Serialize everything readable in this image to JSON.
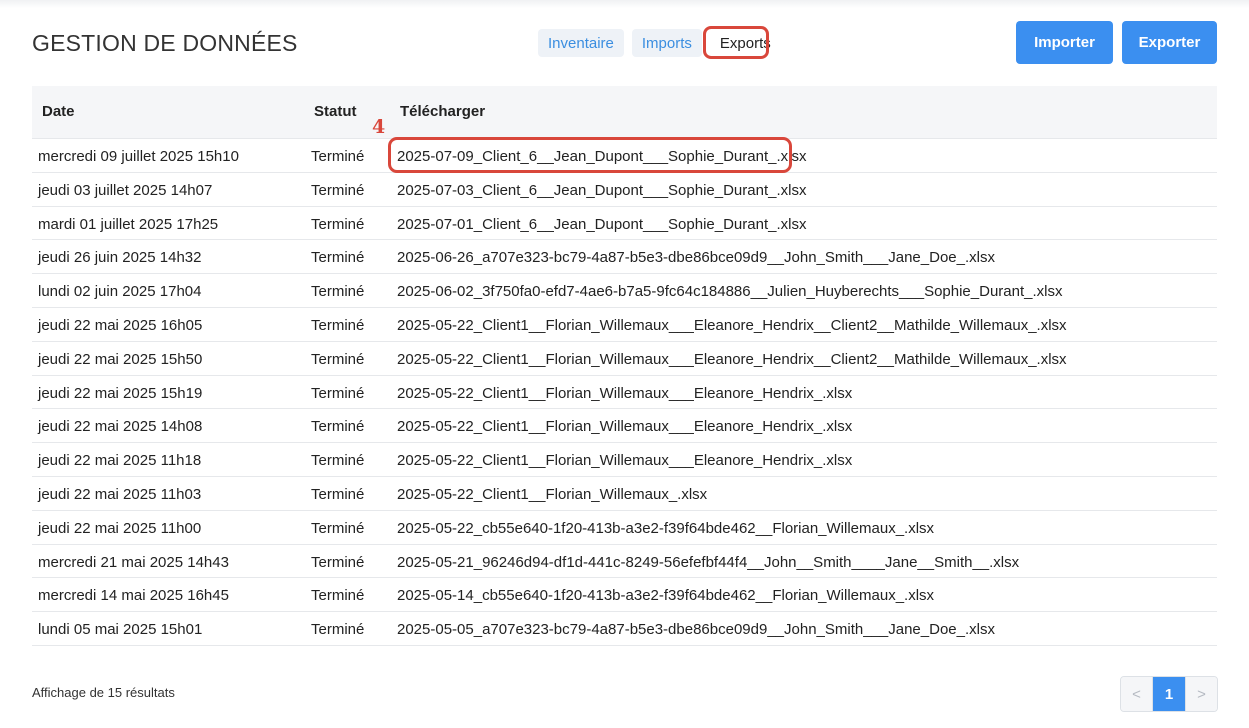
{
  "page": {
    "title": "GESTION DE DONNÉES"
  },
  "tabs": [
    {
      "label": "Inventaire",
      "active": false
    },
    {
      "label": "Imports",
      "active": false
    },
    {
      "label": "Exports",
      "active": true
    }
  ],
  "actions": {
    "import_label": "Importer",
    "export_label": "Exporter"
  },
  "table": {
    "headers": {
      "date": "Date",
      "status": "Statut",
      "download": "Télécharger"
    },
    "rows": [
      {
        "date": "mercredi 09 juillet 2025 15h10",
        "status": "Terminé",
        "file": "2025-07-09_Client_6__Jean_Dupont___Sophie_Durant_.xlsx"
      },
      {
        "date": "jeudi 03 juillet 2025 14h07",
        "status": "Terminé",
        "file": "2025-07-03_Client_6__Jean_Dupont___Sophie_Durant_.xlsx"
      },
      {
        "date": "mardi 01 juillet 2025 17h25",
        "status": "Terminé",
        "file": "2025-07-01_Client_6__Jean_Dupont___Sophie_Durant_.xlsx"
      },
      {
        "date": "jeudi 26 juin 2025 14h32",
        "status": "Terminé",
        "file": "2025-06-26_a707e323-bc79-4a87-b5e3-dbe86bce09d9__John_Smith___Jane_Doe_.xlsx"
      },
      {
        "date": "lundi 02 juin 2025 17h04",
        "status": "Terminé",
        "file": "2025-06-02_3f750fa0-efd7-4ae6-b7a5-9fc64c184886__Julien_Huyberechts___Sophie_Durant_.xlsx"
      },
      {
        "date": "jeudi 22 mai 2025 16h05",
        "status": "Terminé",
        "file": "2025-05-22_Client1__Florian_Willemaux___Eleanore_Hendrix__Client2__Mathilde_Willemaux_.xlsx"
      },
      {
        "date": "jeudi 22 mai 2025 15h50",
        "status": "Terminé",
        "file": "2025-05-22_Client1__Florian_Willemaux___Eleanore_Hendrix__Client2__Mathilde_Willemaux_.xlsx"
      },
      {
        "date": "jeudi 22 mai 2025 15h19",
        "status": "Terminé",
        "file": "2025-05-22_Client1__Florian_Willemaux___Eleanore_Hendrix_.xlsx"
      },
      {
        "date": "jeudi 22 mai 2025 14h08",
        "status": "Terminé",
        "file": "2025-05-22_Client1__Florian_Willemaux___Eleanore_Hendrix_.xlsx"
      },
      {
        "date": "jeudi 22 mai 2025 11h18",
        "status": "Terminé",
        "file": "2025-05-22_Client1__Florian_Willemaux___Eleanore_Hendrix_.xlsx"
      },
      {
        "date": "jeudi 22 mai 2025 11h03",
        "status": "Terminé",
        "file": "2025-05-22_Client1__Florian_Willemaux_.xlsx"
      },
      {
        "date": "jeudi 22 mai 2025 11h00",
        "status": "Terminé",
        "file": "2025-05-22_cb55e640-1f20-413b-a3e2-f39f64bde462__Florian_Willemaux_.xlsx"
      },
      {
        "date": "mercredi 21 mai 2025 14h43",
        "status": "Terminé",
        "file": "2025-05-21_96246d94-df1d-441c-8249-56efefbf44f4__John__Smith____Jane__Smith__.xlsx"
      },
      {
        "date": "mercredi 14 mai 2025 16h45",
        "status": "Terminé",
        "file": "2025-05-14_cb55e640-1f20-413b-a3e2-f39f64bde462__Florian_Willemaux_.xlsx"
      },
      {
        "date": "lundi 05 mai 2025 15h01",
        "status": "Terminé",
        "file": "2025-05-05_a707e323-bc79-4a87-b5e3-dbe86bce09d9__John_Smith___Jane_Doe_.xlsx"
      }
    ]
  },
  "annotation": {
    "number": "4",
    "color": "#d9473b"
  },
  "footer": {
    "results_text": "Affichage de 15 résultats"
  },
  "pagination": {
    "prev": "<",
    "current": "1",
    "next": ">"
  },
  "colors": {
    "primary": "#3b8ff0",
    "annotation": "#d9473b"
  }
}
